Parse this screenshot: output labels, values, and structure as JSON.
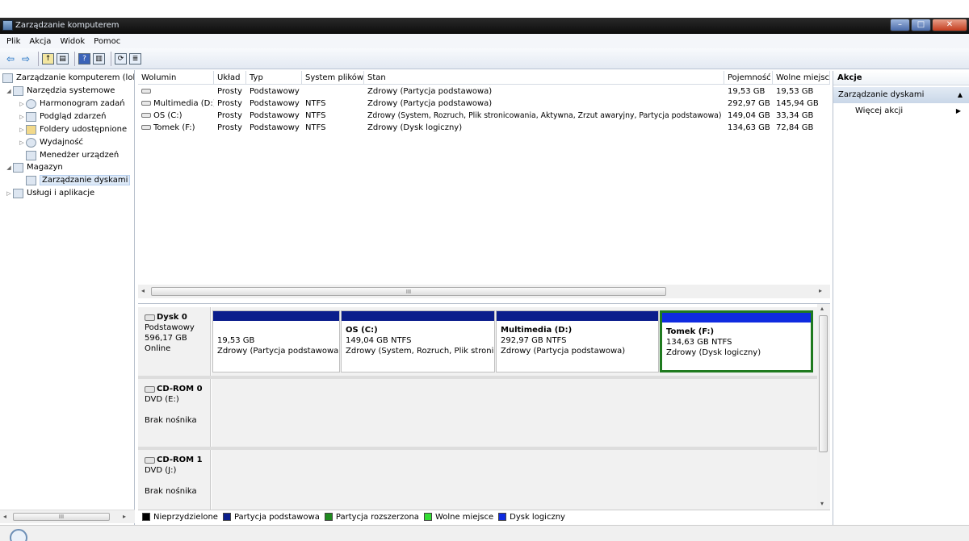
{
  "window": {
    "title": "Zarządzanie komputerem",
    "minimize_glyph": "–",
    "maximize_glyph": "□",
    "close_glyph": "✕"
  },
  "menu": [
    "Plik",
    "Akcja",
    "Widok",
    "Pomoc"
  ],
  "toolbar_icons": [
    "back-arrow-icon",
    "forward-arrow-icon",
    "up-folder-icon",
    "show-hide-tree-icon",
    "help-icon",
    "show-hide-action-pane-icon",
    "refresh-icon",
    "properties-icon"
  ],
  "tree": {
    "root": "Zarządzanie komputerem (lokalne)",
    "items": [
      {
        "label": "Narzędzia systemowe",
        "level": 1,
        "expanded": true
      },
      {
        "label": "Harmonogram zadań",
        "level": 2
      },
      {
        "label": "Podgląd zdarzeń",
        "level": 2
      },
      {
        "label": "Foldery udostępnione",
        "level": 2
      },
      {
        "label": "Wydajność",
        "level": 2
      },
      {
        "label": "Menedżer urządzeń",
        "level": 2
      },
      {
        "label": "Magazyn",
        "level": 1,
        "expanded": true
      },
      {
        "label": "Zarządzanie dyskami",
        "level": 2,
        "selected": true
      },
      {
        "label": "Usługi i aplikacje",
        "level": 1
      }
    ],
    "scroll_glyph": "III"
  },
  "volumes": {
    "headers": [
      "Wolumin",
      "Układ",
      "Typ",
      "System plików",
      "Stan",
      "Pojemność",
      "Wolne miejsce"
    ],
    "rows": [
      [
        "",
        "Prosty",
        "Podstawowy",
        "",
        "Zdrowy (Partycja podstawowa)",
        "19,53 GB",
        "19,53 GB"
      ],
      [
        "Multimedia (D:)",
        "Prosty",
        "Podstawowy",
        "NTFS",
        "Zdrowy (Partycja podstawowa)",
        "292,97 GB",
        "145,94 GB"
      ],
      [
        "OS (C:)",
        "Prosty",
        "Podstawowy",
        "NTFS",
        "Zdrowy (System, Rozruch, Plik stronicowania, Aktywna, Zrzut awaryjny, Partycja podstawowa)",
        "149,04 GB",
        "33,34 GB"
      ],
      [
        "Tomek (F:)",
        "Prosty",
        "Podstawowy",
        "NTFS",
        "Zdrowy (Dysk logiczny)",
        "134,63 GB",
        "72,84 GB"
      ]
    ],
    "scroll_glyph": "III"
  },
  "disks": [
    {
      "name": "Dysk 0",
      "type": "Podstawowy",
      "size": "596,17 GB",
      "status": "Online",
      "partitions": [
        {
          "name": "",
          "size": "19,53 GB",
          "status": "Zdrowy (Partycja podstawowa)",
          "kind": "primary"
        },
        {
          "name": "OS  (C:)",
          "size": "149,04 GB NTFS",
          "status": "Zdrowy (System, Rozruch, Plik stronicowania, Aktywna...)",
          "kind": "primary"
        },
        {
          "name": "Multimedia  (D:)",
          "size": "292,97 GB NTFS",
          "status": "Zdrowy (Partycja podstawowa)",
          "kind": "primary"
        },
        {
          "name": "Tomek  (F:)",
          "size": "134,63 GB NTFS",
          "status": "Zdrowy (Dysk logiczny)",
          "kind": "logical",
          "selected": true
        }
      ]
    },
    {
      "name": "CD-ROM 0",
      "type": "DVD (E:)",
      "size": "",
      "status": "Brak nośnika",
      "partitions": []
    },
    {
      "name": "CD-ROM 1",
      "type": "DVD (J:)",
      "size": "",
      "status": "Brak nośnika",
      "partitions": []
    }
  ],
  "legend": [
    {
      "label": "Nieprzydzielone",
      "color": "#000000"
    },
    {
      "label": "Partycja podstawowa",
      "color": "#0b1e8c"
    },
    {
      "label": "Partycja rozszerzona",
      "color": "#1f8a1f"
    },
    {
      "label": "Wolne miejsce",
      "color": "#33dd33"
    },
    {
      "label": "Dysk logiczny",
      "color": "#0f2be0"
    }
  ],
  "actions": {
    "header": "Akcje",
    "section": "Zarządzanie dyskami",
    "items": [
      "Więcej akcji"
    ],
    "collapse_glyph": "▲",
    "more_glyph": "▶"
  },
  "scroll_arrows": {
    "left": "◂",
    "right": "▸",
    "up": "▴",
    "down": "▾"
  }
}
